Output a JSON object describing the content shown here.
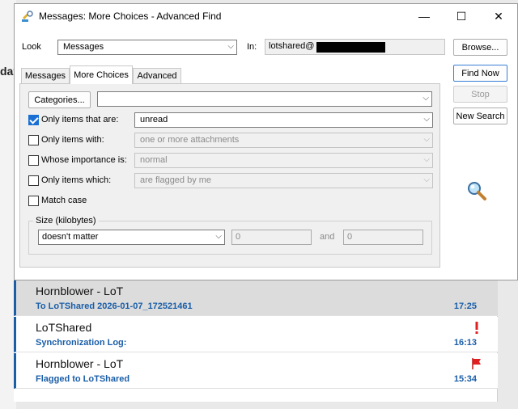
{
  "window": {
    "title": "Messages: More Choices - Advanced Find",
    "minimize": "—",
    "maximize": "☐",
    "close": "✕"
  },
  "background": {
    "day_fragment": "day"
  },
  "look": {
    "label": "Look",
    "value": "Messages",
    "in_label": "In:",
    "in_value": "lotshared@"
  },
  "buttons": {
    "browse": "Browse...",
    "find_now": "Find Now",
    "stop": "Stop",
    "new_search": "New Search"
  },
  "tabs": [
    {
      "label": "Messages",
      "active": false
    },
    {
      "label": "More Choices",
      "active": true
    },
    {
      "label": "Advanced",
      "active": false
    }
  ],
  "more_choices": {
    "categories_button": "Categories...",
    "categories_value": "",
    "only_items_that_are": {
      "label": "Only items that are:",
      "checked": true,
      "value": "unread"
    },
    "only_items_with": {
      "label": "Only items with:",
      "checked": false,
      "value": "one or more attachments"
    },
    "whose_importance": {
      "label": "Whose importance is:",
      "checked": false,
      "value": "normal"
    },
    "only_items_which": {
      "label": "Only items which:",
      "checked": false,
      "value": "are flagged by me"
    },
    "match_case": {
      "label": "Match case",
      "checked": false
    },
    "size": {
      "title": "Size (kilobytes)",
      "condition": "doesn't matter",
      "from": "0",
      "and_label": "and",
      "to": "0"
    }
  },
  "results": [
    {
      "from": "Hornblower - LoT",
      "subject": "To LoTShared 2026-01-07_172521461",
      "time": "17:25",
      "flag": "none",
      "selected": true
    },
    {
      "from": "LoTShared",
      "subject": "Synchronization Log:",
      "time": "16:13",
      "flag": "importance",
      "selected": false
    },
    {
      "from": "Hornblower - LoT",
      "subject": "Flagged to LoTShared",
      "time": "15:34",
      "flag": "flag",
      "selected": false
    }
  ],
  "colors": {
    "accent": "#1a6fd4",
    "subject_blue": "#1a5ea8",
    "flag_red": "#e02020"
  }
}
